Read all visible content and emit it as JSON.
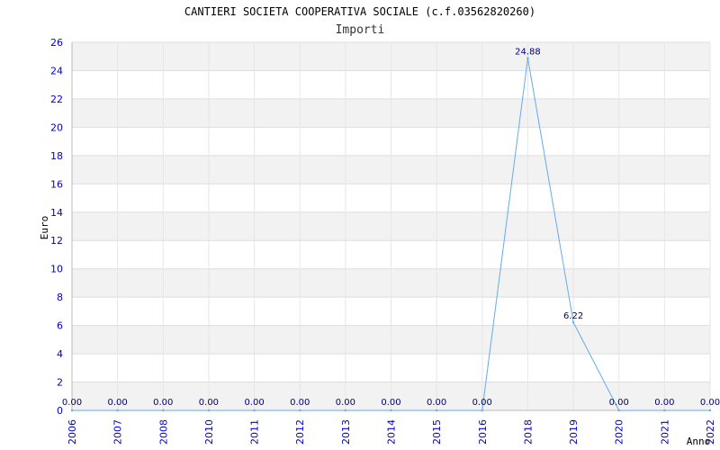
{
  "chart_data": {
    "type": "line",
    "title": "CANTIERI SOCIETA COOPERATIVA SOCIALE (c.f.03562820260)",
    "subtitle": "Importi",
    "xlabel": "Anno",
    "ylabel": "Euro",
    "categories": [
      "2006",
      "2007",
      "2008",
      "2010",
      "2011",
      "2012",
      "2013",
      "2014",
      "2015",
      "2016",
      "2018",
      "2019",
      "2020",
      "2021",
      "2022"
    ],
    "values": [
      0,
      0,
      0,
      0,
      0,
      0,
      0,
      0,
      0,
      0,
      24.88,
      6.22,
      0,
      0,
      0
    ],
    "data_labels": [
      "0.00",
      "0.00",
      "0.00",
      "0.00",
      "0.00",
      "0.00",
      "0.00",
      "0.00",
      "0.00",
      "0.00",
      "24.88",
      "6.22",
      "0.00",
      "0.00",
      "0.00"
    ],
    "ylim": [
      0,
      26
    ],
    "yticks": [
      0,
      2,
      4,
      6,
      8,
      10,
      12,
      14,
      16,
      18,
      20,
      22,
      24,
      26
    ],
    "grid": true,
    "legend": "none",
    "colors": {
      "line": "#66aaee",
      "band": "#f2f2f2",
      "grid": "#dddddd",
      "tick_text": "#0000cc",
      "data_label": "#000080"
    }
  }
}
